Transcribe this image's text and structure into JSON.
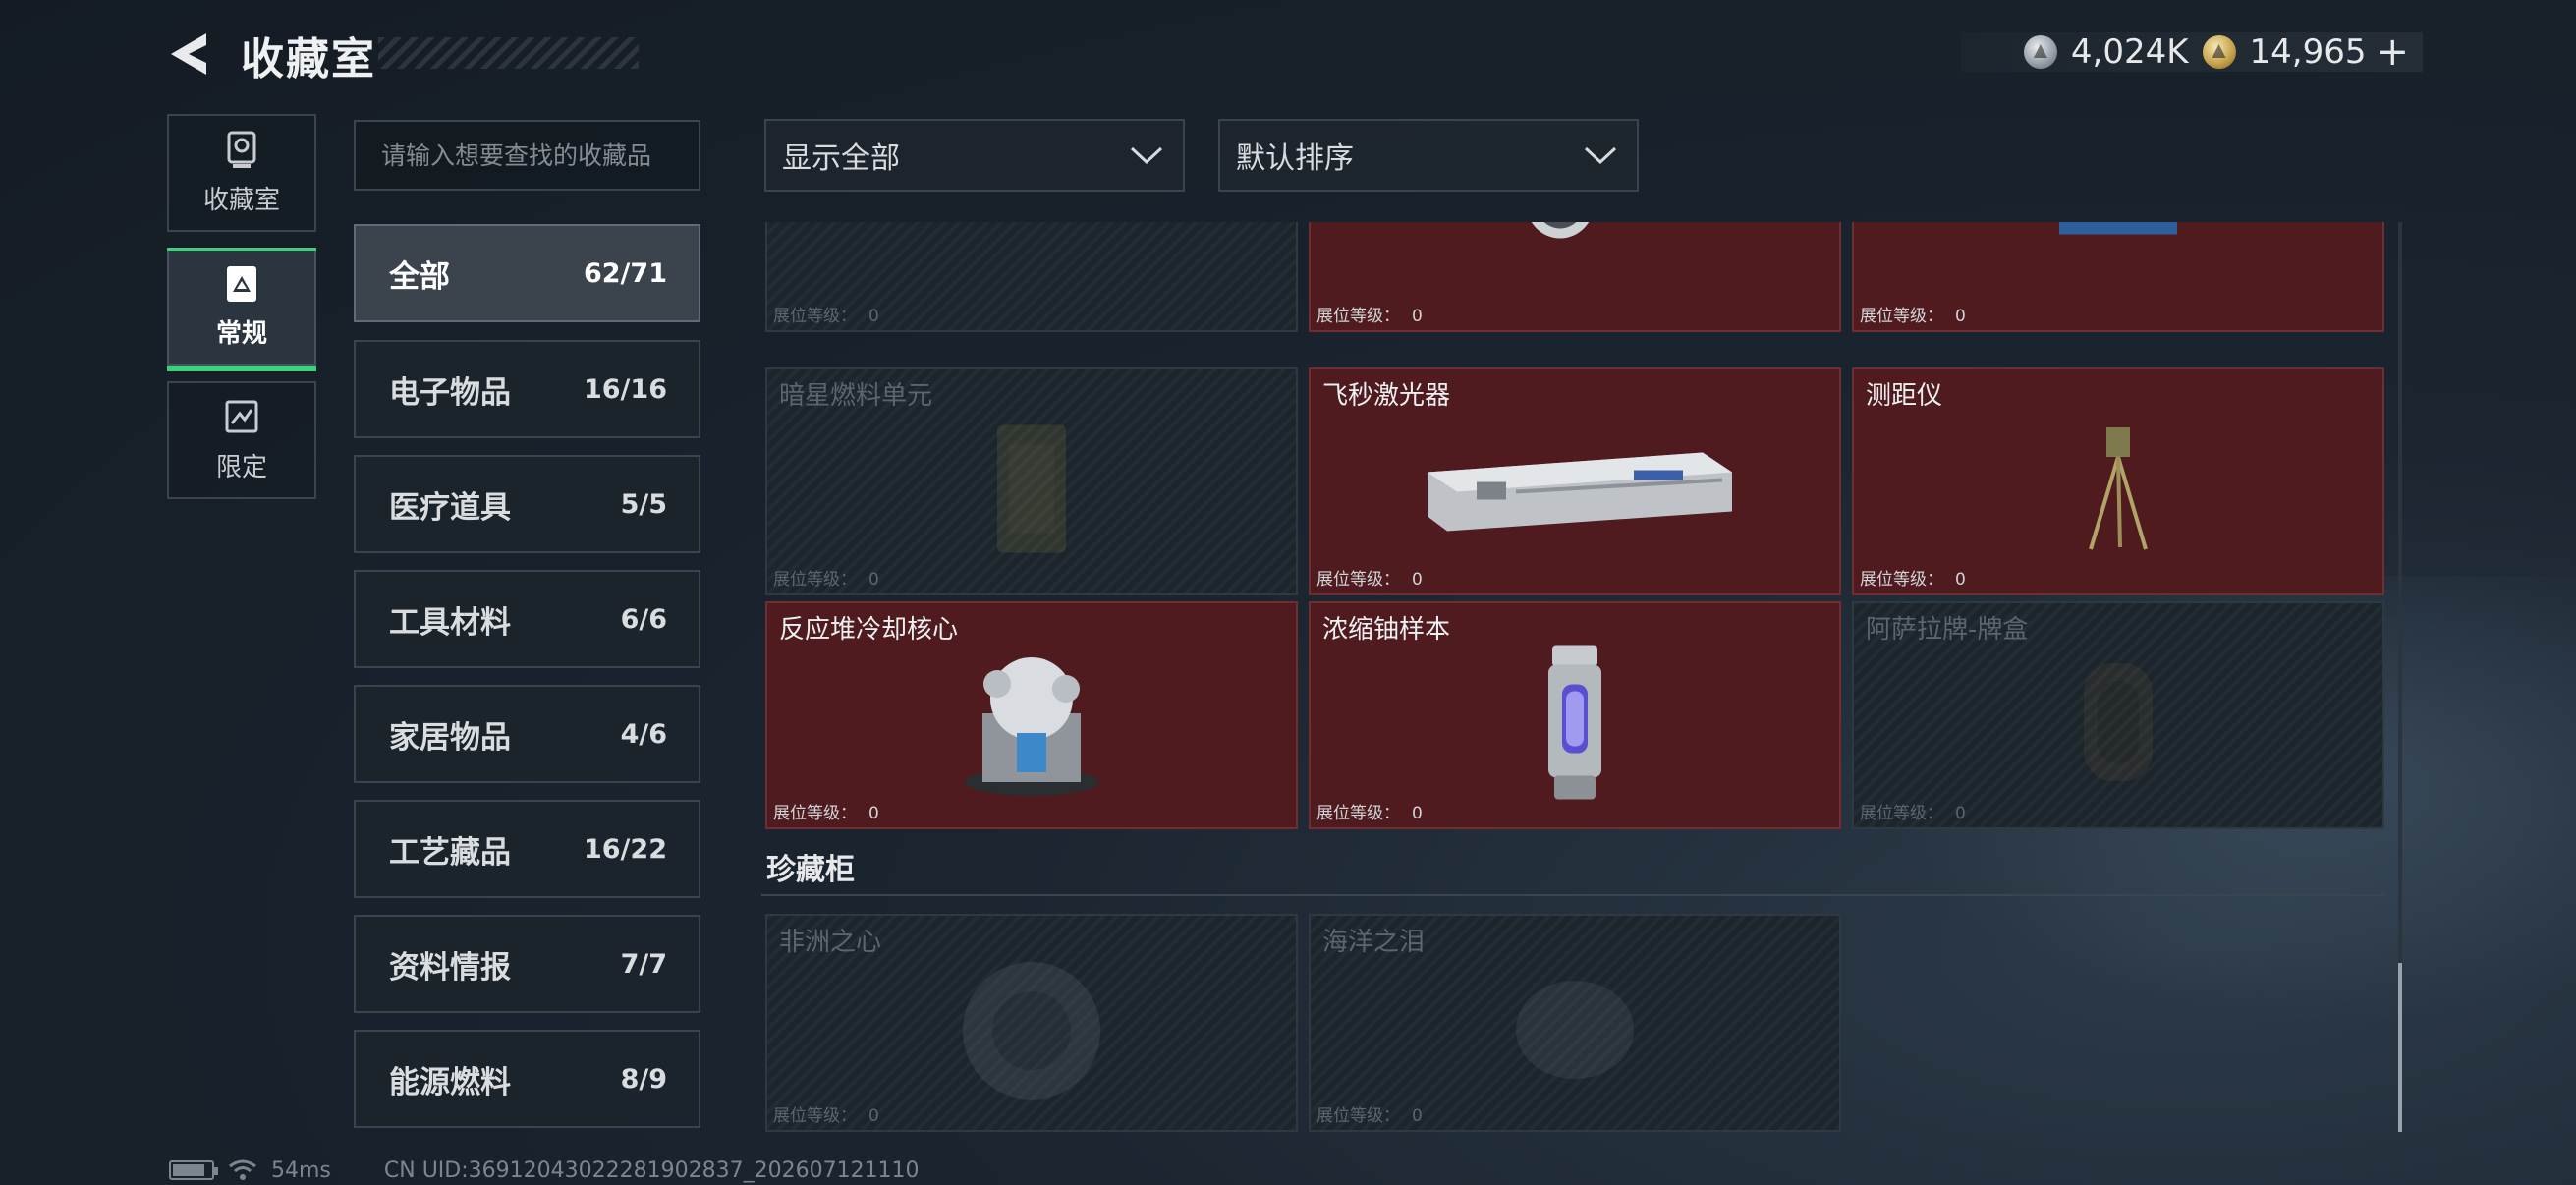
{
  "header": {
    "title": "收藏室",
    "silver_value": "4,024K",
    "gold_value": "14,965",
    "plus_label": "+"
  },
  "side_tabs": [
    {
      "label": "收藏室",
      "icon": "trophy-icon",
      "active": false
    },
    {
      "label": "常规",
      "icon": "card-icon",
      "active": true
    },
    {
      "label": "限定",
      "icon": "limited-icon",
      "active": false
    }
  ],
  "search": {
    "placeholder": "请输入想要查找的收藏品"
  },
  "categories": [
    {
      "name": "全部",
      "count": "62/71",
      "active": true
    },
    {
      "name": "电子物品",
      "count": "16/16"
    },
    {
      "name": "医疗道具",
      "count": "5/5"
    },
    {
      "name": "工具材料",
      "count": "6/6"
    },
    {
      "name": "家居物品",
      "count": "4/6"
    },
    {
      "name": "工艺藏品",
      "count": "16/22"
    },
    {
      "name": "资料情报",
      "count": "7/7"
    },
    {
      "name": "能源燃料",
      "count": "8/9"
    }
  ],
  "filters": {
    "show": "显示全部",
    "sort": "默认排序"
  },
  "level_label": "展位等级：",
  "items": [
    {
      "name": "",
      "level": "0",
      "owned": false,
      "art": "none"
    },
    {
      "name": "",
      "level": "0",
      "owned": true,
      "art": "lens-icon"
    },
    {
      "name": "",
      "level": "0",
      "owned": true,
      "art": "machine-icon"
    },
    {
      "name": "暗星燃料单元",
      "level": "0",
      "owned": false,
      "art": "fuel-cell-icon"
    },
    {
      "name": "飞秒激光器",
      "level": "0",
      "owned": true,
      "art": "laser-icon"
    },
    {
      "name": "测距仪",
      "level": "0",
      "owned": true,
      "art": "tripod-icon"
    },
    {
      "name": "反应堆冷却核心",
      "level": "0",
      "owned": true,
      "art": "reactor-core-icon"
    },
    {
      "name": "浓缩铀样本",
      "level": "0",
      "owned": true,
      "art": "canister-icon"
    },
    {
      "name": "阿萨拉牌-牌盒",
      "level": "0",
      "owned": false,
      "art": "card-box-icon"
    }
  ],
  "showcase": {
    "title": "珍藏柜",
    "items": [
      {
        "name": "非洲之心",
        "level": "0",
        "owned": false,
        "art": "gem-icon"
      },
      {
        "name": "海洋之泪",
        "level": "0",
        "owned": false,
        "art": "gem-icon"
      }
    ]
  },
  "footer": {
    "ping": "54ms",
    "uid": "CN UID:36912043022281902837_202607121110"
  },
  "colors": {
    "accent_green": "#3fd07a",
    "owned_bg": "#4f1b1e",
    "locked_bg": "#1c242c"
  }
}
